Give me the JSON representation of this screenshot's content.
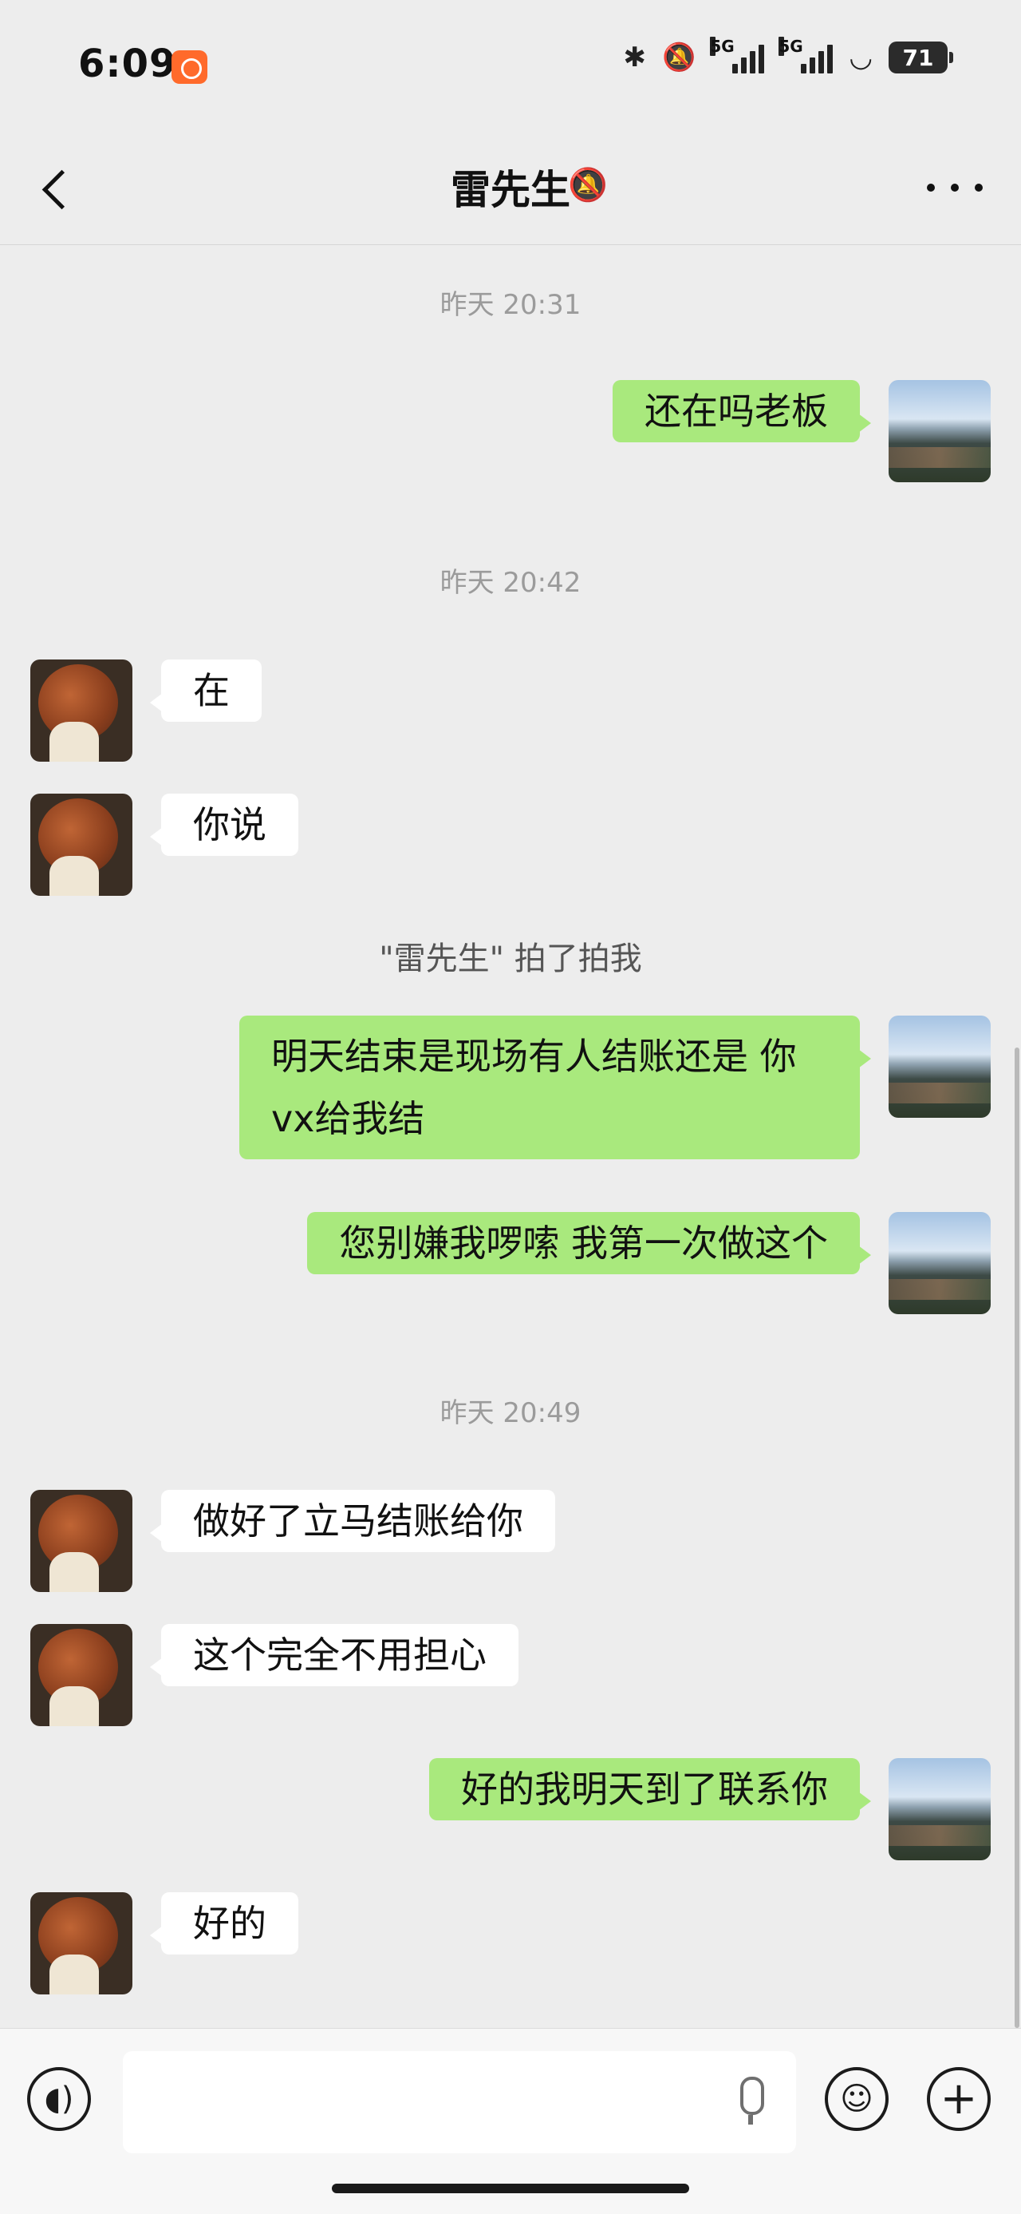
{
  "status_bar": {
    "time": "6:09",
    "network_1": "5G",
    "network_2": "5G",
    "battery": "71",
    "icons": [
      "bluetooth-icon",
      "mute-icon",
      "signal-icon",
      "wifi-icon",
      "battery-icon"
    ]
  },
  "header": {
    "title": "雷先生",
    "back_icon": "chevron-left-icon",
    "mute_icon": "bell-off-icon",
    "more_icon": "more-icon"
  },
  "messages": [
    {
      "kind": "time",
      "text": "昨天 20:31"
    },
    {
      "kind": "out",
      "text": "还在吗老板"
    },
    {
      "kind": "time",
      "text": "昨天 20:42"
    },
    {
      "kind": "in",
      "text": "在"
    },
    {
      "kind": "in",
      "text": "你说"
    },
    {
      "kind": "system",
      "text": "\"雷先生\" 拍了拍我"
    },
    {
      "kind": "out",
      "text": "明天结束是现场有人结账还是 你vx给我结"
    },
    {
      "kind": "out",
      "text": "您别嫌我啰嗦 我第一次做这个"
    },
    {
      "kind": "time",
      "text": "昨天 20:49"
    },
    {
      "kind": "in",
      "text": "做好了立马结账给你"
    },
    {
      "kind": "in",
      "text": "这个完全不用担心"
    },
    {
      "kind": "out",
      "text": "好的我明天到了联系你"
    },
    {
      "kind": "in",
      "text": "好的"
    }
  ],
  "input_bar": {
    "value": "",
    "icons": [
      "voice-icon",
      "mic-icon",
      "emoji-icon",
      "plus-icon"
    ]
  },
  "colors": {
    "background": "#ededed",
    "bubble_out": "#a9e97d",
    "bubble_in": "#ffffff",
    "timestamp": "#9b9b9b"
  }
}
